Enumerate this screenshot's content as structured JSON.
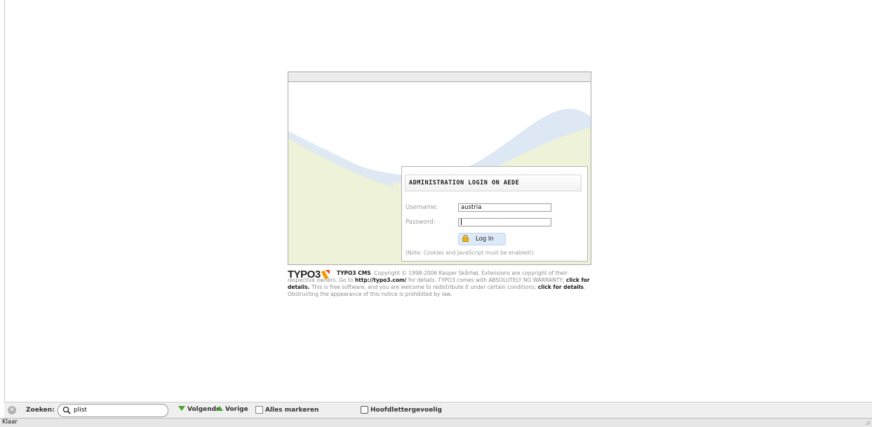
{
  "login": {
    "title": "ADMINISTRATION LOGIN ON AEDE",
    "username_label": "Username:",
    "username_value": "austria",
    "password_label": "Password:",
    "login_button": "Log In",
    "note": "(Note: Cookies and JavaScript must be enabled!)"
  },
  "footer": {
    "logo_text": "TYPO3",
    "brand": "TYPO3 CMS",
    "text_a": ". Copyright © 1998-2006 Kasper Skårhøj. Extensions are copyright of their respective owners. Go to ",
    "link_url": "http://typo3.com/",
    "text_b": " for details. TYPO3 comes with ABSOLUTELY NO WARRANTY; ",
    "link_details_1": "click for details.",
    "text_c": " This is free software, and you are welcome to redistribute it under certain conditions; ",
    "link_details_2": "click for details",
    "text_d": ". Obstructing the appearance of this notice is prohibited by law."
  },
  "findbar": {
    "label": "Zoeken:",
    "query": "plist",
    "next": "Volgende",
    "previous": "Vorige",
    "highlight_all": "Alles markeren",
    "match_case": "Hoofdlettergevoelig"
  },
  "statusbar": {
    "text": "Klaar"
  },
  "colors": {
    "wave_blue": "#dde8f4",
    "wave_green": "#eef2d8",
    "accent_green": "#4aa12f",
    "typo3_orange": "#f49700"
  },
  "icons": [
    "lock-icon",
    "typo3-logo-icon",
    "close-icon",
    "search-icon",
    "arrow-down-icon",
    "arrow-up-icon",
    "highlight-icon",
    "checkbox-icon",
    "resize-grip-icon"
  ]
}
